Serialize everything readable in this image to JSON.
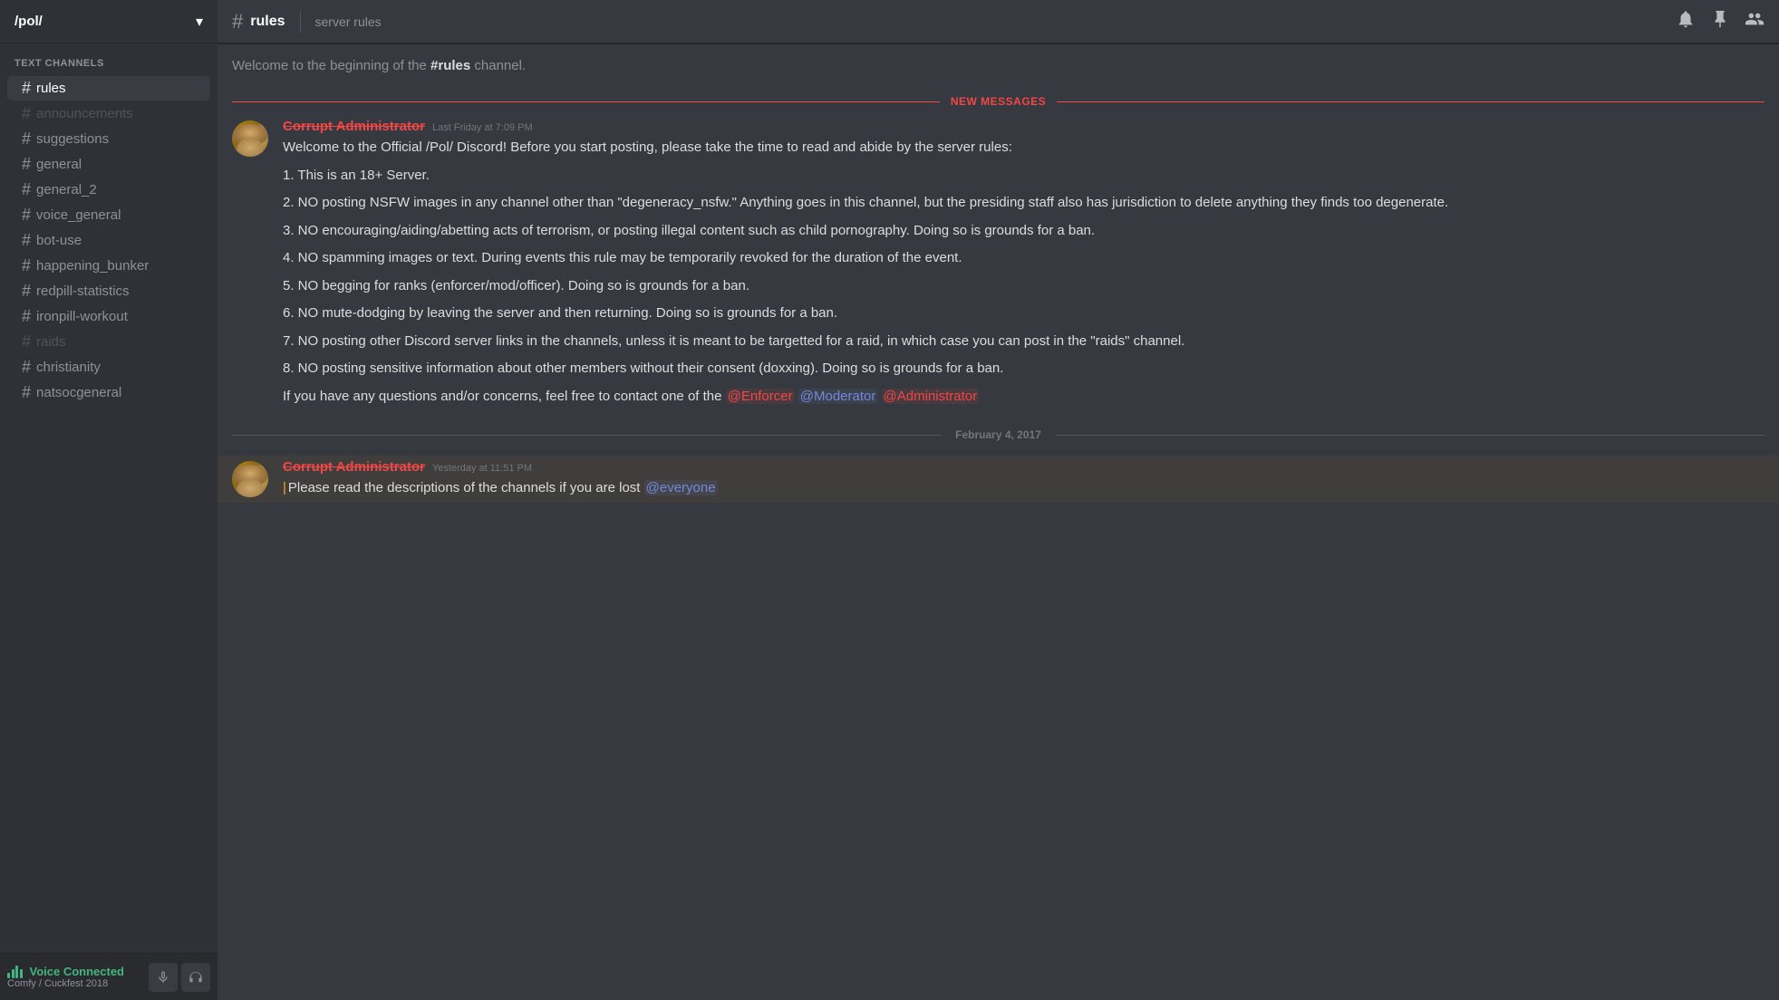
{
  "server": {
    "name": "/pol/",
    "chevron": "▾"
  },
  "sidebar": {
    "sections": [
      {
        "label": "TEXT CHANNELS",
        "channels": [
          {
            "name": "rules",
            "active": true,
            "muted": false
          },
          {
            "name": "announcements",
            "active": false,
            "muted": true
          },
          {
            "name": "suggestions",
            "active": false,
            "muted": false
          },
          {
            "name": "general",
            "active": false,
            "muted": false
          },
          {
            "name": "general_2",
            "active": false,
            "muted": false
          },
          {
            "name": "voice_general",
            "active": false,
            "muted": false
          },
          {
            "name": "bot-use",
            "active": false,
            "muted": false
          },
          {
            "name": "happening_bunker",
            "active": false,
            "muted": false
          },
          {
            "name": "redpill-statistics",
            "active": false,
            "muted": false
          },
          {
            "name": "ironpill-workout",
            "active": false,
            "muted": false
          },
          {
            "name": "raids",
            "active": false,
            "muted": true
          },
          {
            "name": "christianity",
            "active": false,
            "muted": false
          },
          {
            "name": "natsocgeneral",
            "active": false,
            "muted": false
          }
        ]
      }
    ],
    "voice": {
      "status": "Voice Connected",
      "channel": "Comfy / Cuckfest 2018"
    }
  },
  "header": {
    "channel": "rules",
    "topic": "server rules"
  },
  "messages": {
    "channel_start": "Welcome to the beginning of the #rules channel.",
    "new_messages_label": "NEW MESSAGES",
    "message1": {
      "author": "Corrupt Administrator",
      "timestamp": "Last Friday at 7:09 PM",
      "lines": [
        "Welcome to the Official /Pol/ Discord! Before you start posting, please take the time to read and abide by the server rules:",
        "1. This is an 18+ Server.",
        "2. NO posting NSFW images in any channel other than \"degeneracy_nsfw.\" Anything goes in this channel, but the presiding staff also has jurisdiction to delete anything they finds too degenerate.",
        "3. NO encouraging/aiding/abetting acts of terrorism, or posting illegal content such as child pornography. Doing so is grounds for a ban.",
        "4. NO spamming images or text. During events this rule may be temporarily revoked for the duration of the event.",
        "5. NO begging for ranks (enforcer/mod/officer). Doing so is grounds for a ban.",
        "6. NO mute-dodging by leaving the server and then returning. Doing so is grounds for a ban.",
        "7. NO posting other Discord server links in the channels, unless it is meant to be targetted for a raid, in which case you can post in the \"raids\" channel.",
        "8. NO posting sensitive information about other members without their consent (doxxing). Doing so is grounds for a ban.",
        "If you have any questions and/or concerns, feel free to contact one of the @Enforcer @Moderator @Administrator"
      ]
    },
    "date_divider": "February 4, 2017",
    "message2": {
      "author": "Corrupt Administrator",
      "timestamp": "Yesterday at 11:51 PM",
      "text": "Please read the descriptions of the channels if you are lost @everyone"
    }
  }
}
